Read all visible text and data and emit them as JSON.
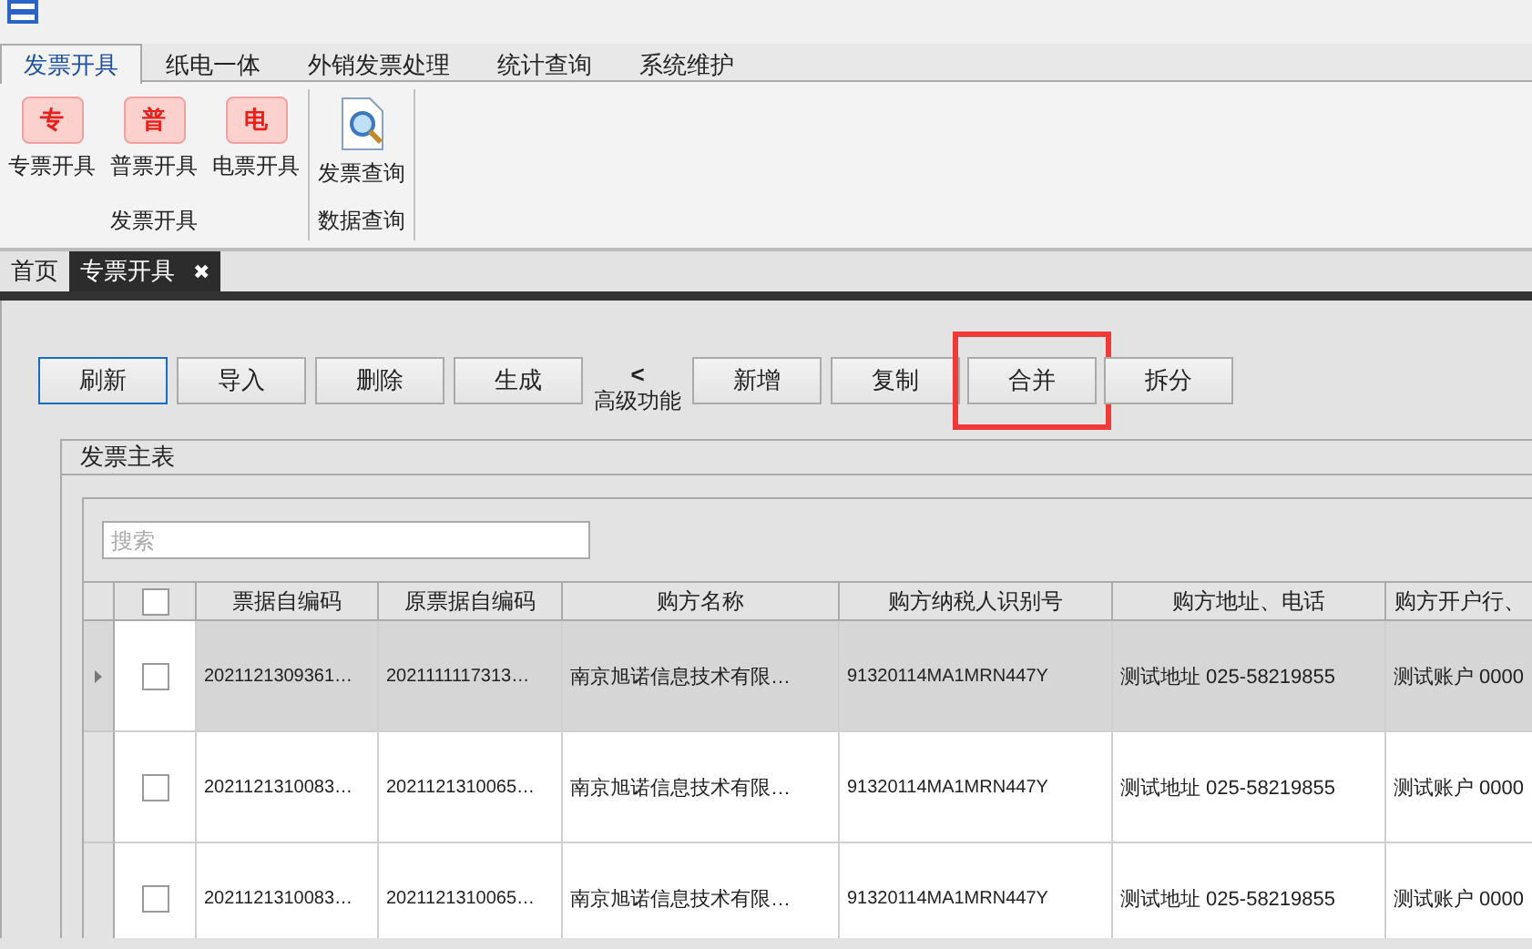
{
  "ribbon_tabs": [
    {
      "label": "发票开具",
      "selected": true
    },
    {
      "label": "纸电一体",
      "selected": false
    },
    {
      "label": "外销发票处理",
      "selected": false
    },
    {
      "label": "统计查询",
      "selected": false
    },
    {
      "label": "系统维护",
      "selected": false
    }
  ],
  "ribbon_groups": [
    {
      "title": "发票开具",
      "items": [
        {
          "kind": "ticket",
          "glyph": "专",
          "label": "专票开具"
        },
        {
          "kind": "ticket",
          "glyph": "普",
          "label": "普票开具"
        },
        {
          "kind": "ticket",
          "glyph": "电",
          "label": "电票开具"
        }
      ]
    },
    {
      "title": "数据查询",
      "items": [
        {
          "kind": "search_doc",
          "label": "发票查询"
        }
      ]
    }
  ],
  "doc_tabs": [
    {
      "label": "首页",
      "selected": false,
      "closable": false
    },
    {
      "label": "专票开具",
      "selected": true,
      "closable": true,
      "close": "✖"
    }
  ],
  "toolbar": [
    {
      "kind": "button",
      "label": "刷新",
      "focused": true,
      "highlighted": false
    },
    {
      "kind": "button",
      "label": "导入",
      "focused": false,
      "highlighted": false
    },
    {
      "kind": "button",
      "label": "删除",
      "focused": false,
      "highlighted": false
    },
    {
      "kind": "button",
      "label": "生成",
      "focused": false,
      "highlighted": false
    },
    {
      "kind": "toggle",
      "arrow": "<",
      "label": "高级功能"
    },
    {
      "kind": "button",
      "label": "新增",
      "focused": false,
      "highlighted": false
    },
    {
      "kind": "button",
      "label": "复制",
      "focused": false,
      "highlighted": false
    },
    {
      "kind": "button",
      "label": "合并",
      "focused": false,
      "highlighted": true
    },
    {
      "kind": "button",
      "label": "拆分",
      "focused": false,
      "highlighted": false
    }
  ],
  "panel": {
    "title": "发票主表",
    "search": {
      "placeholder": "搜索"
    },
    "table": {
      "header_checked": false,
      "columns": [
        "票据自编码",
        "原票据自编码",
        "购方名称",
        "购方纳税人识别号",
        "购方地址、电话",
        "购方开户行、"
      ],
      "rows": [
        {
          "selected": true,
          "checked": false,
          "cells": [
            "2021121309361…",
            "2021111117313…",
            "南京旭诺信息技术有限…",
            "91320114MA1MRN447Y",
            "测试地址 025-58219855",
            "测试账户 0000"
          ]
        },
        {
          "selected": false,
          "checked": false,
          "cells": [
            "2021121310083…",
            "2021121310065…",
            "南京旭诺信息技术有限…",
            "91320114MA1MRN447Y",
            "测试地址 025-58219855",
            "测试账户 0000"
          ]
        },
        {
          "selected": false,
          "checked": false,
          "cells": [
            "2021121310083…",
            "2021121310065…",
            "南京旭诺信息技术有限…",
            "91320114MA1MRN447Y",
            "测试地址 025-58219855",
            "测试账户 0000"
          ]
        }
      ]
    }
  }
}
